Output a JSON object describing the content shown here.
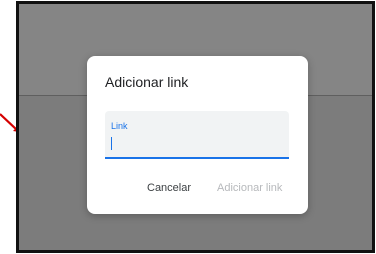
{
  "dialog": {
    "title": "Adicionar link",
    "field": {
      "label": "Link",
      "value": ""
    },
    "actions": {
      "cancel_label": "Cancelar",
      "add_label": "Adicionar link"
    }
  },
  "colors": {
    "accent": "#1a73e8",
    "overlay": "#808080",
    "annotation_arrow": "#d40000",
    "disabled_text": "#b7b9bc"
  },
  "icons": [
    "red-annotation-arrow"
  ]
}
